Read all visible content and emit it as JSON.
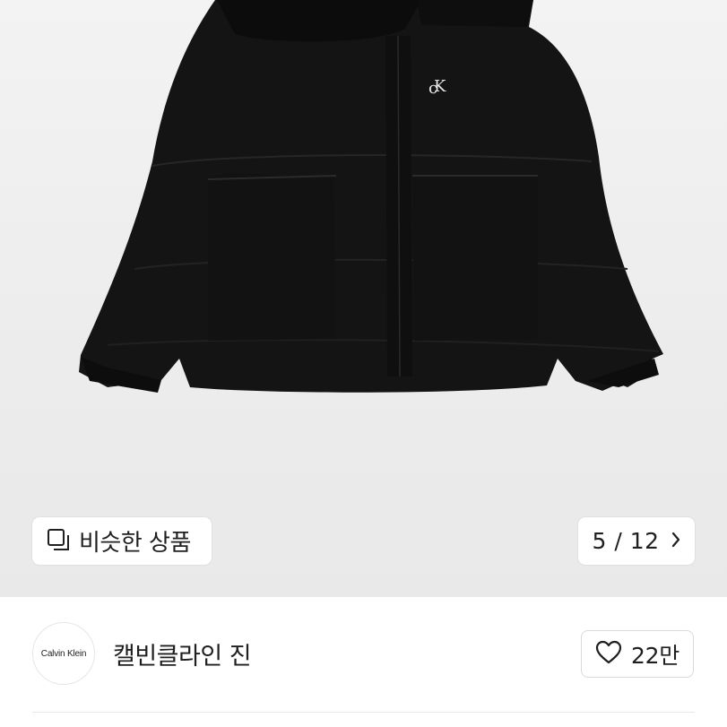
{
  "product_image": {
    "alt": "Calvin Klein black puffer jacket",
    "similar_button": {
      "label": "비슷한 상품",
      "icon": "similar-items-icon"
    },
    "counter": {
      "label": "5 / 12",
      "icon": "chevron-right-icon"
    }
  },
  "brand": {
    "logo_text": "Calvin Klein",
    "name": "캘빈클라인 진",
    "like": {
      "count": "22만",
      "icon": "heart-icon"
    }
  }
}
